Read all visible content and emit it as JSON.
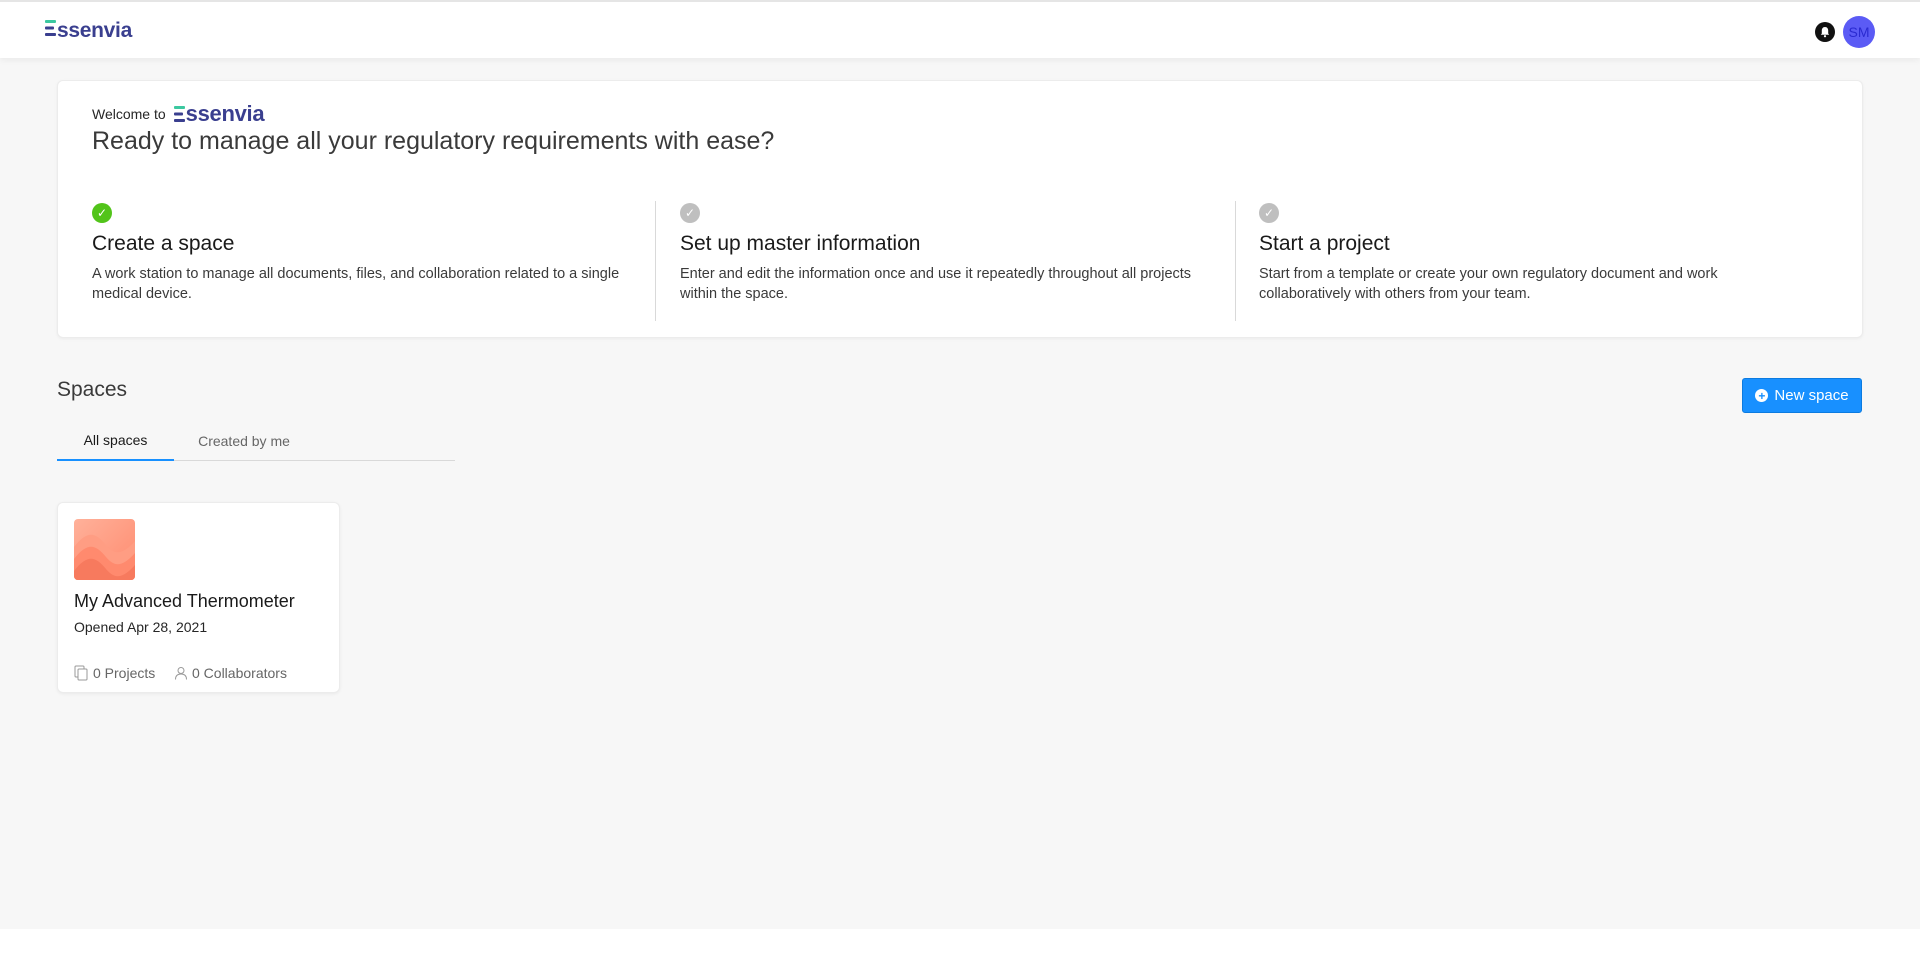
{
  "app": {
    "logo_text": "ssenvia",
    "logo_initial": "E"
  },
  "header": {
    "avatar_initials": "SM"
  },
  "welcome": {
    "intro": "Welcome to",
    "heading": "Ready to manage all your regulatory requirements with ease?",
    "steps": [
      {
        "title": "Create a space",
        "description": "A work station to manage all documents, files, and collaboration related to a single medical device.",
        "status": "complete",
        "color": "#52c41a"
      },
      {
        "title": "Set up master information",
        "description": "Enter and edit the information once and use it repeatedly throughout all projects within the space.",
        "status": "incomplete",
        "color": "#bfbfbf"
      },
      {
        "title": "Start a project",
        "description": "Start from a template or create your own regulatory document and work collaboratively with others from your team.",
        "status": "incomplete",
        "color": "#bfbfbf"
      }
    ]
  },
  "spaces": {
    "title": "Spaces",
    "new_button": "New space",
    "tabs": [
      {
        "label": "All spaces",
        "active": true
      },
      {
        "label": "Created by me",
        "active": false
      }
    ],
    "cards": [
      {
        "name": "My Advanced Thermometer",
        "opened": "Opened Apr 28, 2021",
        "projects": "0 Projects",
        "collaborators": "0 Collaborators"
      }
    ]
  },
  "colors": {
    "accent": "#1890ff",
    "brand": "#3a3f8f",
    "brand_green": "#3cc8a0",
    "avatar": "#5b5bf5"
  },
  "icons": [
    "bell-icon",
    "check-circle-icon",
    "plus-circle-icon",
    "projects-icon",
    "collaborators-icon"
  ]
}
